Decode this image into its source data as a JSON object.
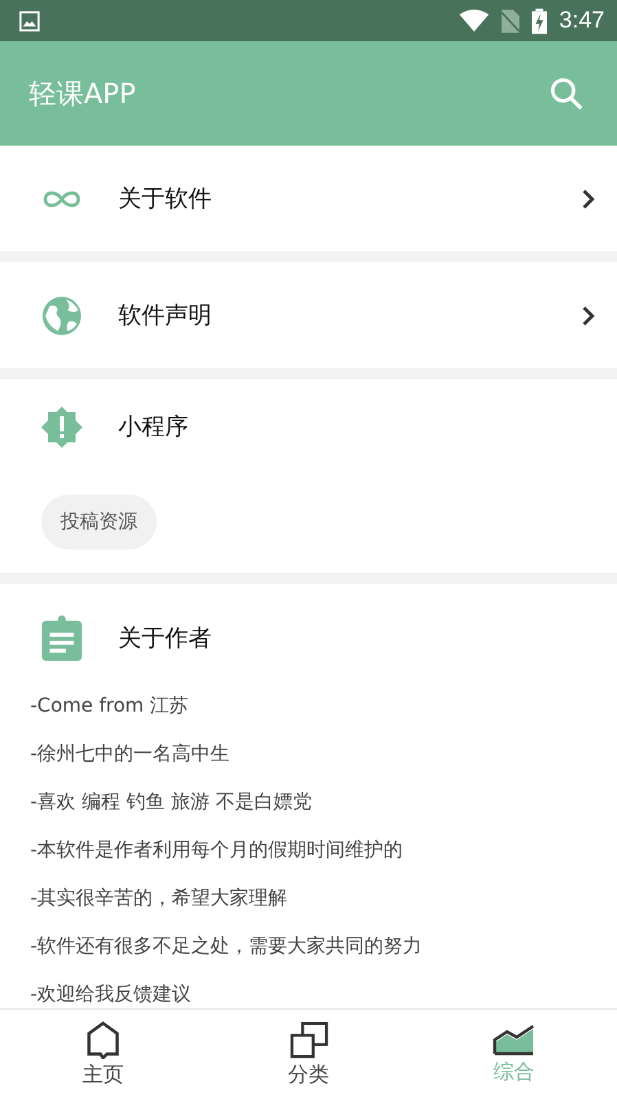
{
  "status_bar": {
    "time": "3:47"
  },
  "app_bar": {
    "title": "轻课APP"
  },
  "sections": [
    {
      "kind": "link",
      "title": "关于软件"
    },
    {
      "kind": "link",
      "title": "软件声明"
    },
    {
      "kind": "chips",
      "title": "小程序",
      "chips": [
        "投稿资源"
      ]
    },
    {
      "kind": "text",
      "title": "关于作者",
      "lines": [
        "-Come from 江苏",
        "-徐州七中的一名高中生",
        "-喜欢 编程 钓鱼 旅游 不是白嫖党",
        "-本软件是作者利用每个月的假期时间维护的",
        "-其实很辛苦的，希望大家理解",
        "-软件还有很多不足之处，需要大家共同的努力",
        "-欢迎给我反馈建议"
      ]
    }
  ],
  "bottom_nav": [
    {
      "label": "主页",
      "selected": false
    },
    {
      "label": "分类",
      "selected": false
    },
    {
      "label": "综合",
      "selected": true
    }
  ]
}
